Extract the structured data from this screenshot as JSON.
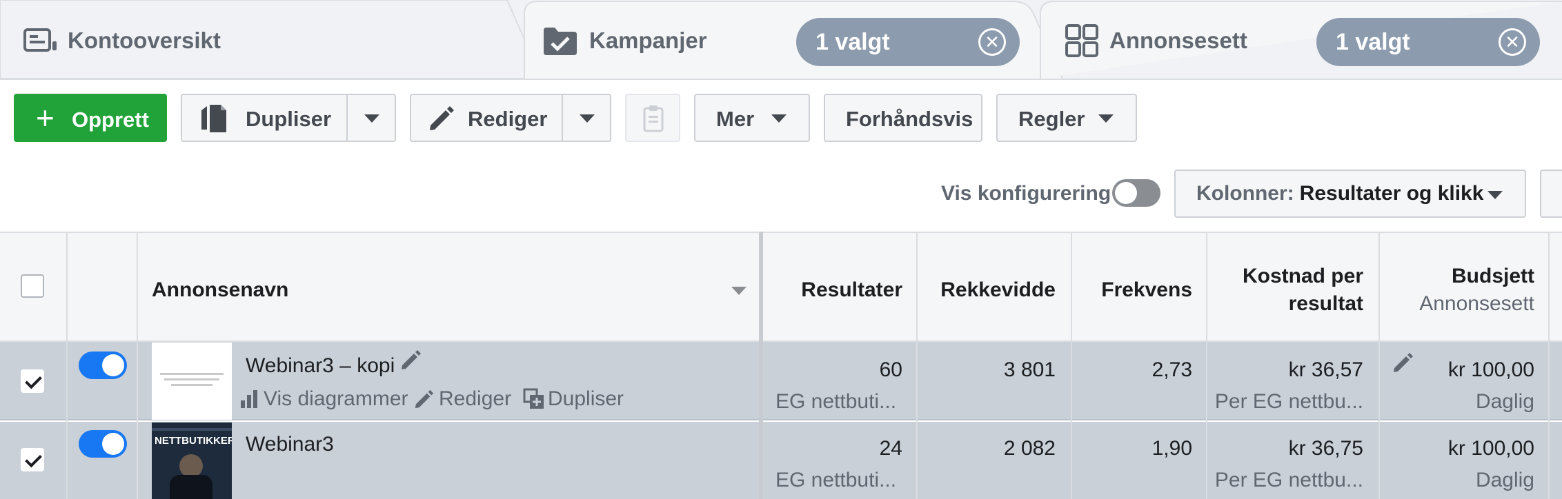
{
  "tabs": [
    {
      "label": "Kontooversikt",
      "icon": "account-overview-icon"
    },
    {
      "label": "Kampanjer",
      "icon": "campaign-folder-icon",
      "pill": "1 valgt"
    },
    {
      "label": "Annonsesett",
      "icon": "grid-icon",
      "pill": "1 valgt"
    }
  ],
  "toolbar": {
    "create": "Opprett",
    "duplicate": "Dupliser",
    "edit": "Rediger",
    "more": "Mer",
    "preview": "Forhåndsvis",
    "rules": "Regler"
  },
  "config": {
    "vis_label": "Vis konfigurering",
    "columns_key": "Kolonner:",
    "columns_value": "Resultater og klikk"
  },
  "table": {
    "headers": {
      "name": "Annonsenavn",
      "results": "Resultater",
      "reach": "Rekkevidde",
      "frequency": "Frekvens",
      "cost_line1": "Kostnad per",
      "cost_line2": "resultat",
      "budget": "Budsjett",
      "budget_sub": "Annonsesett"
    },
    "row_actions": {
      "charts": "Vis diagrammer",
      "edit": "Rediger",
      "duplicate": "Dupliser"
    },
    "rows": [
      {
        "name": "Webinar3 – kopi",
        "checked": true,
        "active": true,
        "results": "60",
        "results_sub": "EG nettbuti...",
        "reach": "3 801",
        "frequency": "2,73",
        "cost": "kr 36,57",
        "cost_sub": "Per EG nettbu...",
        "budget": "kr 100,00",
        "budget_sub": "Daglig"
      },
      {
        "name": "Webinar3",
        "checked": true,
        "active": true,
        "results": "24",
        "results_sub": "EG nettbuti...",
        "reach": "2 082",
        "frequency": "1,90",
        "cost": "kr 36,75",
        "cost_sub": "Per EG nettbu...",
        "budget": "kr 100,00",
        "budget_sub": "Daglig",
        "thumb_text": "NETTBUTIKKER"
      }
    ]
  },
  "colors": {
    "create_green": "#21a339",
    "toggle_blue": "#1877f2",
    "selected_row": "#c9d0d8",
    "pill": "#8d9bae"
  }
}
